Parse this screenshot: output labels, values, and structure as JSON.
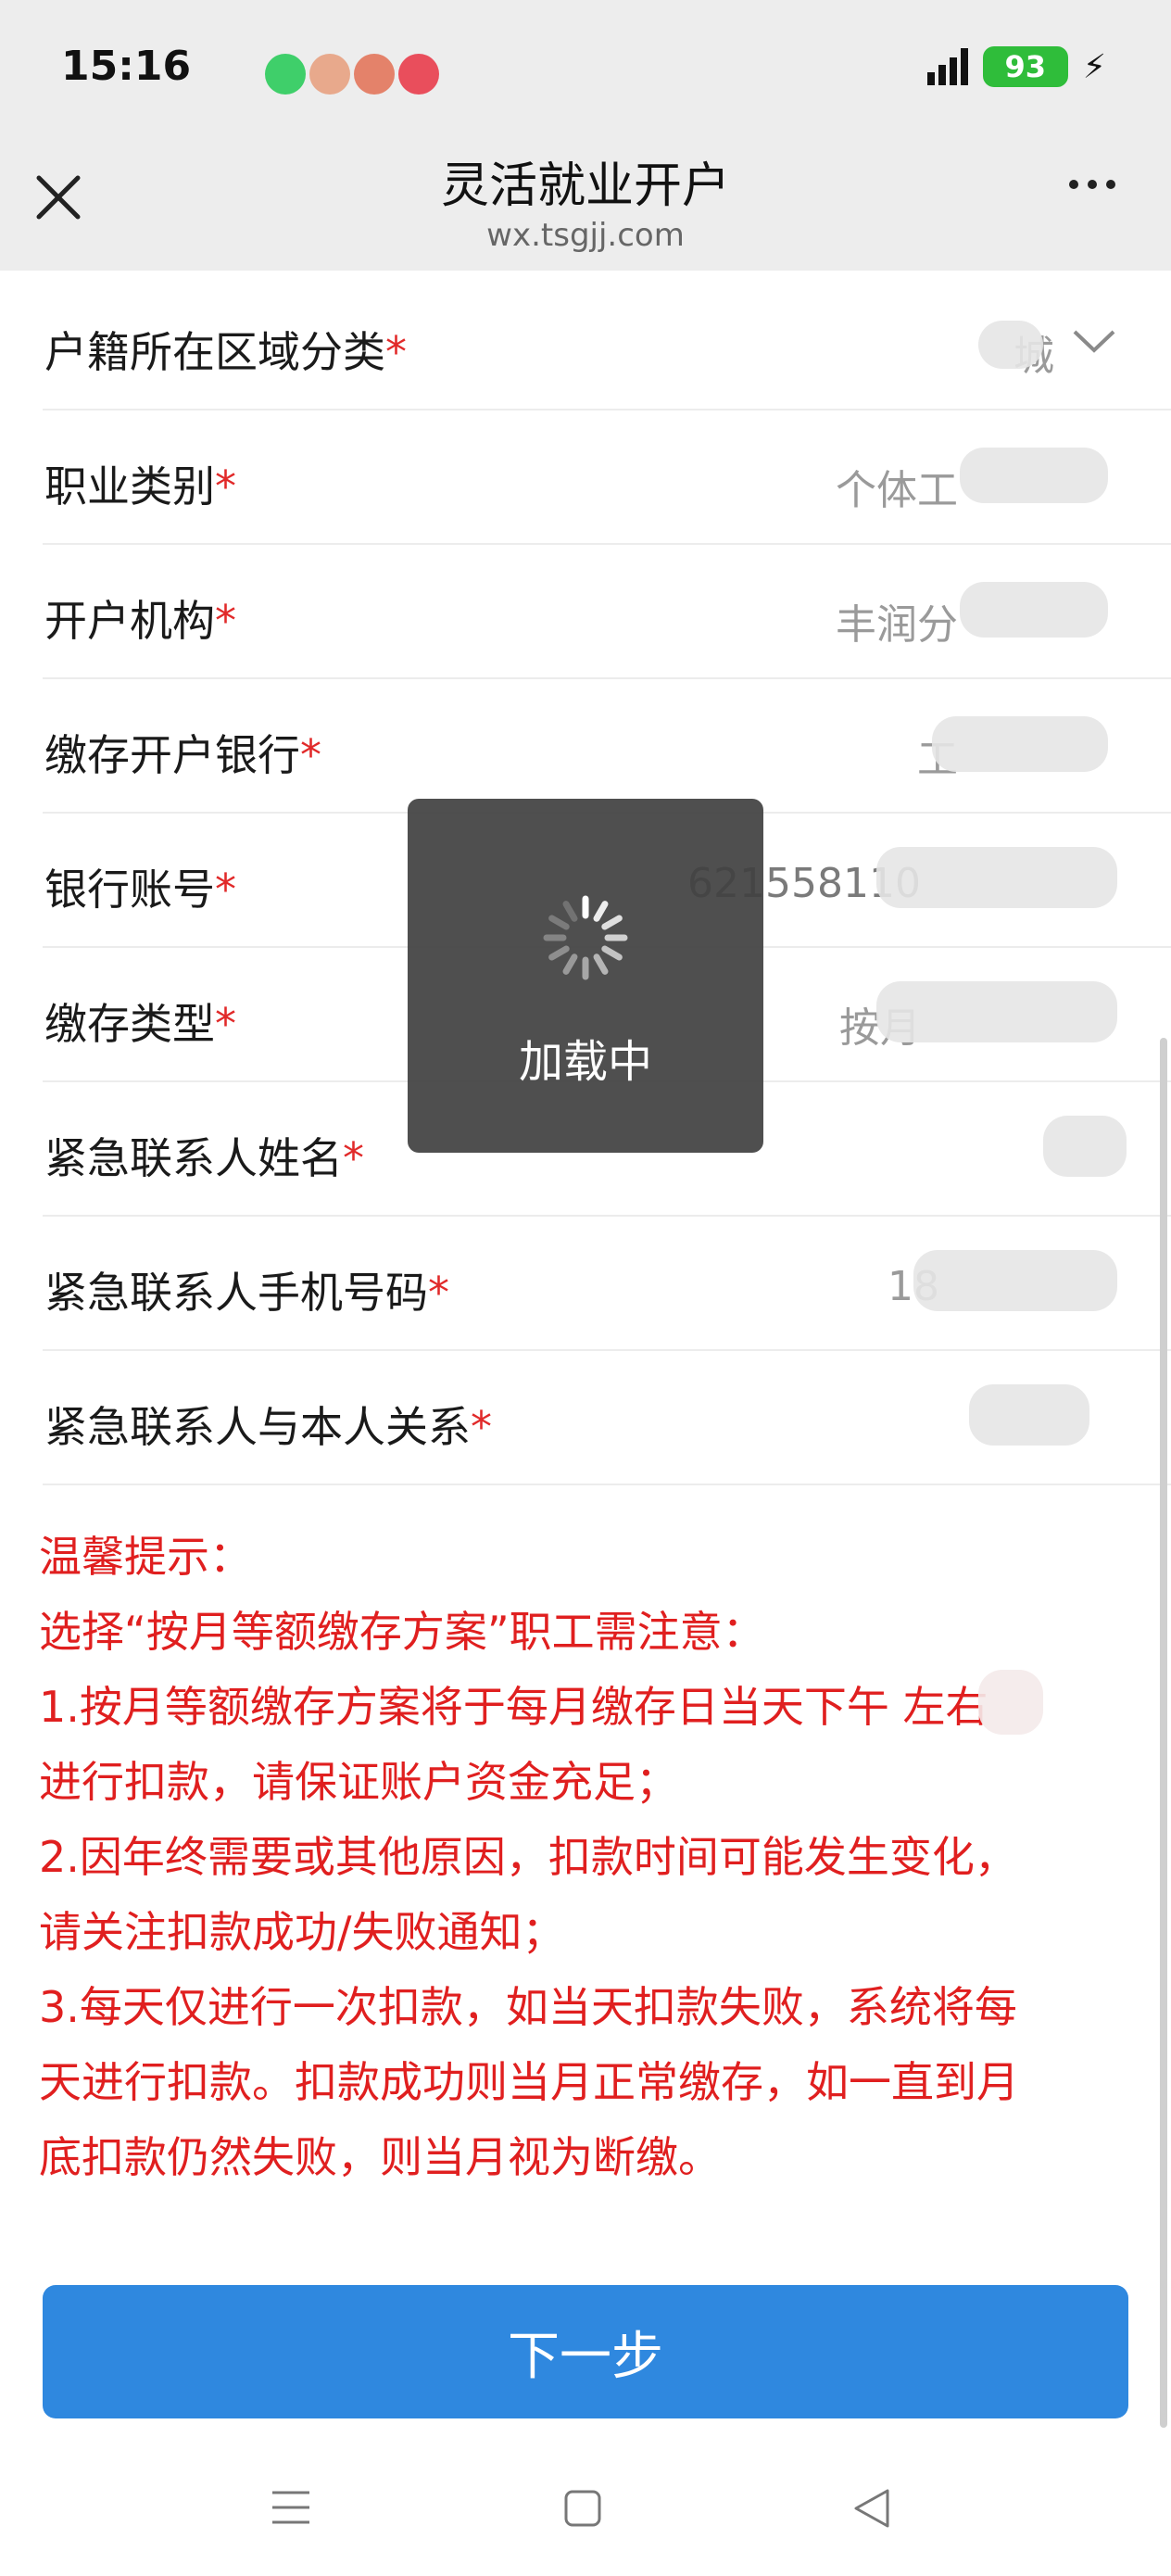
{
  "status_bar": {
    "time": "15:16",
    "battery": "93",
    "dot_colors": [
      "#3fcf6a",
      "#e8a98c",
      "#e4826a",
      "#e94e5c"
    ]
  },
  "header": {
    "title": "灵活就业开户",
    "url": "wx.tsgjj.com",
    "close_icon": "close-icon",
    "more_icon": "more-icon"
  },
  "form": {
    "rows": [
      {
        "label": "户籍所在区域分类",
        "value": "城",
        "has_chevron": true
      },
      {
        "label": "职业类别",
        "value": "个体工",
        "has_chevron": true
      },
      {
        "label": "开户机构",
        "value": "丰润分",
        "has_chevron": false
      },
      {
        "label": "缴存开户银行",
        "value": "工",
        "has_chevron": false
      },
      {
        "label": "银行账号",
        "value": "621558110",
        "has_chevron": false
      },
      {
        "label": "缴存类型",
        "value": "按月",
        "has_chevron": false
      },
      {
        "label": "紧急联系人姓名",
        "value": "",
        "has_chevron": false
      },
      {
        "label": "紧急联系人手机号码",
        "value": "18",
        "has_chevron": false
      },
      {
        "label": "紧急联系人与本人关系",
        "value": "",
        "has_chevron": false
      }
    ],
    "required_mark": "*"
  },
  "notice": {
    "lines": [
      "温馨提示：",
      "选择“按月等额缴存方案”职工需注意：",
      "1.按月等额缴存方案将于每月缴存日当天下午        左右",
      "进行扣款，请保证账户资金充足；",
      "2.因年终需要或其他原因，扣款时间可能发生变化，",
      "请关注扣款成功/失败通知；",
      "3.每天仅进行一次扣款，如当天扣款失败，系统将每",
      "天进行扣款。扣款成功则当月正常缴存，如一直到月",
      "底扣款仍然失败，则当月视为断缴。"
    ],
    "color": "#e01f1f"
  },
  "next_button": {
    "label": "下一步",
    "color": "#2f88df"
  },
  "loading_toast": {
    "text": "加载中"
  }
}
